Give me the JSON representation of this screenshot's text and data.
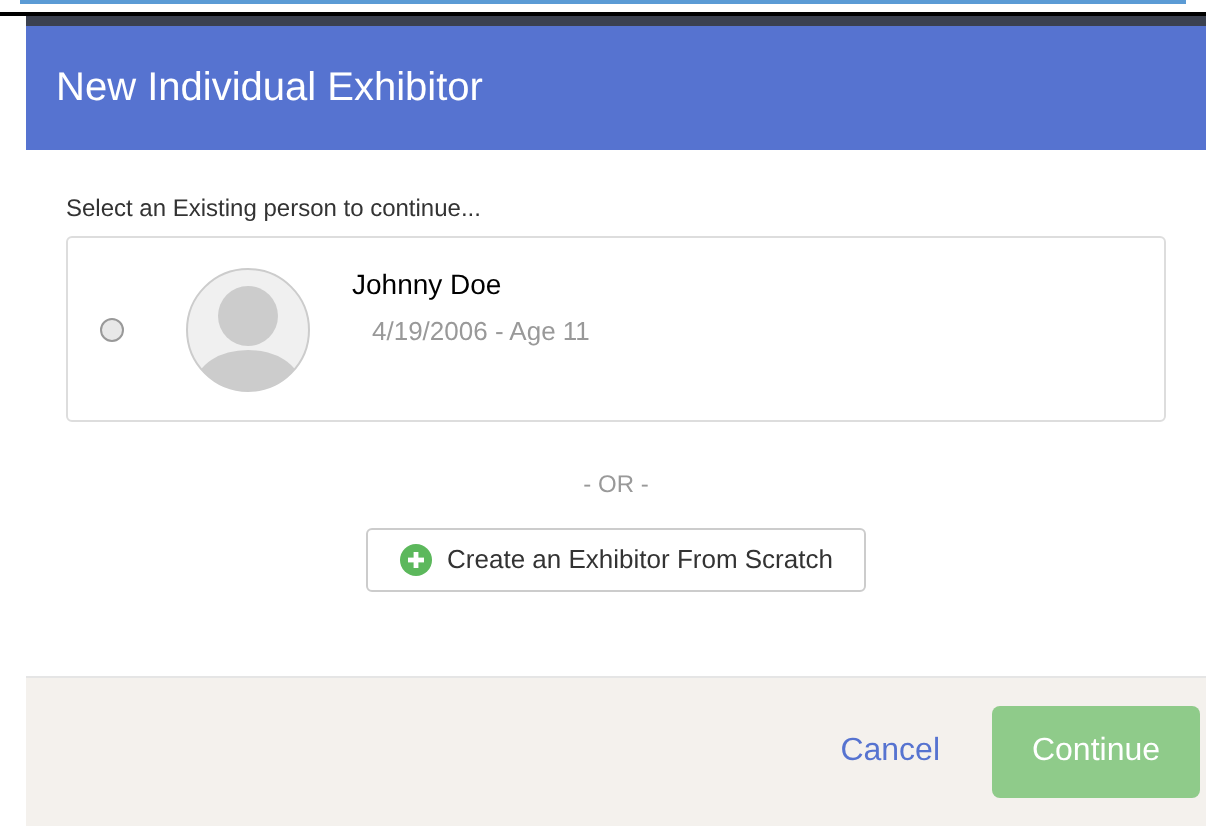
{
  "dialog": {
    "title": "New Individual Exhibitor",
    "prompt": "Select an Existing person to continue...",
    "people": [
      {
        "name": "Johnny Doe",
        "details": "4/19/2006 - Age 11",
        "selected": false
      }
    ],
    "separator": "- OR -",
    "create_button": "Create an Exhibitor From Scratch",
    "cancel": "Cancel",
    "continue": {
      "label": "Continue",
      "disabled": true
    }
  }
}
